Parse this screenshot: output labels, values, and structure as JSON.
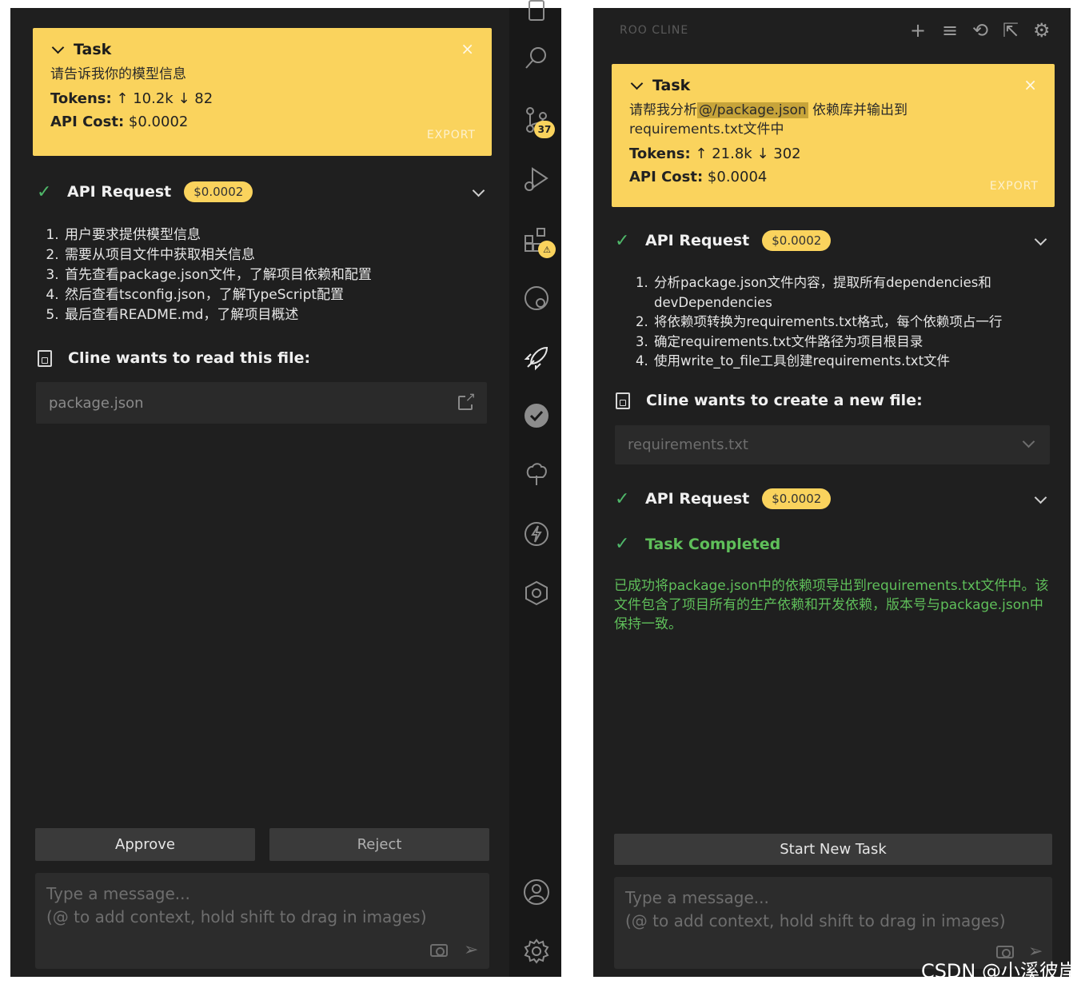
{
  "left": {
    "task": {
      "header": "Task",
      "close": "×",
      "text": "请告诉我你的模型信息",
      "tokens_label": "Tokens:",
      "tokens_in": "↑ 10.2k",
      "tokens_out": "↓ 82",
      "cost_label": "API Cost:",
      "cost_value": "$0.0002",
      "export": "EXPORT"
    },
    "api_request": {
      "label": "API Request",
      "cost": "$0.0002"
    },
    "steps": [
      "用户要求提供模型信息",
      "需要从项目文件中获取相关信息",
      "首先查看package.json文件，了解项目依赖和配置",
      "然后查看tsconfig.json，了解TypeScript配置",
      "最后查看README.md，了解项目概述"
    ],
    "read_file": {
      "label": "Cline wants to read this file:",
      "file": "package.json"
    },
    "approve": "Approve",
    "reject": "Reject",
    "input": {
      "line1": "Type a message...",
      "line2": "(@ to add context, hold shift to drag in images)"
    }
  },
  "activity": {
    "badge_count": "37",
    "icons": [
      "files-icon",
      "search-icon",
      "source-control-icon",
      "run-debug-icon",
      "extensions-icon",
      "remote-icon",
      "rocket-icon",
      "check-circle-icon",
      "tree-icon",
      "lightning-icon",
      "gitlens-icon",
      "account-icon",
      "settings-icon"
    ]
  },
  "right": {
    "title": "ROO CLINE",
    "toolbar": [
      "+",
      "≡",
      "⟲",
      "⇱",
      "⚙"
    ],
    "task": {
      "header": "Task",
      "close": "×",
      "text_a": "请帮我分析",
      "mention": "@/package.json",
      "text_b": " 依赖库并输出到",
      "text_c": "requirements.txt文件中",
      "tokens_label": "Tokens:",
      "tokens_in": "↑ 21.8k",
      "tokens_out": "↓ 302",
      "cost_label": "API Cost:",
      "cost_value": "$0.0004",
      "export": "EXPORT"
    },
    "api_request_1": {
      "label": "API Request",
      "cost": "$0.0002"
    },
    "steps": [
      "分析package.json文件内容，提取所有dependencies和devDependencies",
      "将依赖项转换为requirements.txt格式，每个依赖项占一行",
      "确定requirements.txt文件路径为项目根目录",
      "使用write_to_file工具创建requirements.txt文件"
    ],
    "create_file": {
      "label": "Cline wants to create a new file:",
      "file": "requirements.txt"
    },
    "api_request_2": {
      "label": "API Request",
      "cost": "$0.0002"
    },
    "task_completed": "Task Completed",
    "result": "已成功将package.json中的依赖项导出到requirements.txt文件中。该文件包含了项目所有的生产依赖和开发依赖，版本号与package.json中保持一致。",
    "start_new_task": "Start New Task",
    "input": {
      "line1": "Type a message...",
      "line2": "(@ to add context, hold shift to drag in images)"
    }
  },
  "watermark": "CSDN @小溪彼岸",
  "colors": {
    "accent": "#fad35d",
    "success": "#4fb86a",
    "panel": "#1f1f1f"
  }
}
